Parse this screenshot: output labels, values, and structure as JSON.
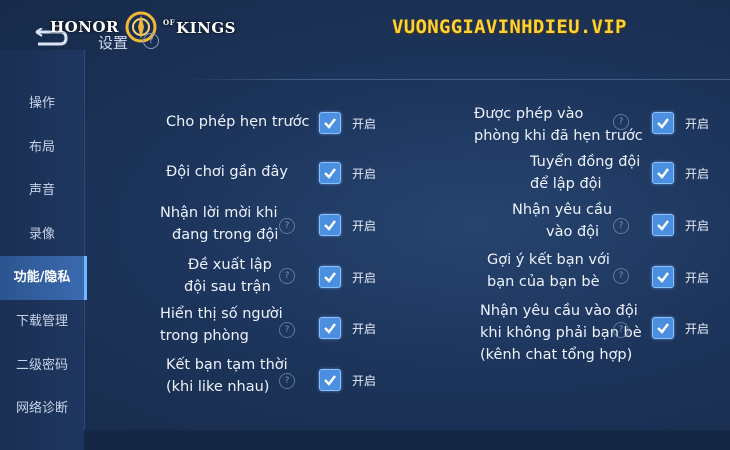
{
  "header": {
    "logo_left": "HONOR",
    "logo_of": "OF",
    "logo_right": "KINGS",
    "page_title": "设置",
    "watermark": "VUONGGIAVINHDIEU.VIP"
  },
  "sidebar": {
    "items": [
      {
        "label": "操作"
      },
      {
        "label": "布局"
      },
      {
        "label": "声音"
      },
      {
        "label": "录像"
      },
      {
        "label": "功能/隐私",
        "active": true
      },
      {
        "label": "下载管理"
      },
      {
        "label": "二级密码"
      },
      {
        "label": "网络诊断"
      }
    ]
  },
  "settings": {
    "left": [
      {
        "line1": "Cho phép hẹn trước",
        "line2": "",
        "checked": true,
        "state": "开启"
      },
      {
        "line1": "Đội chơi gần đây",
        "line2": "",
        "checked": true,
        "state": "开启"
      },
      {
        "line1": "Nhận lời mời khi",
        "line2": "đang trong đội",
        "checked": true,
        "state": "开启"
      },
      {
        "line1": "Đề xuất lập",
        "line2": "đội sau trận",
        "checked": true,
        "state": "开启"
      },
      {
        "line1": "Hiển thị số người",
        "line2": "trong phòng",
        "checked": true,
        "state": "开启"
      },
      {
        "line1": "Kết bạn tạm thời",
        "line2": "(khi like nhau)",
        "checked": true,
        "state": "开启"
      }
    ],
    "right": [
      {
        "line1": "Được phép  vào",
        "line2": "phòng khi đã hẹn trước",
        "line3": "",
        "checked": true,
        "state": "开启"
      },
      {
        "line1": "Tuyển đồng đội",
        "line2": "để lập đội",
        "line3": "",
        "checked": true,
        "state": "开启"
      },
      {
        "line1": "Nhận yêu cầu",
        "line2": "vào đội",
        "line3": "",
        "checked": true,
        "state": "开启"
      },
      {
        "line1": "Gợi ý kết bạn với",
        "line2": "bạn của bạn bè",
        "line3": "",
        "checked": true,
        "state": "开启"
      },
      {
        "line1": "Nhận yêu cầu vào đội",
        "line2": "khi không phải bạn bè",
        "line3": "(kênh chat tổng hợp)",
        "checked": true,
        "state": "开启"
      }
    ]
  },
  "colors": {
    "background": "#1d355c",
    "checkbox": "#4a8fe0",
    "active_tab": "#3b6ab0",
    "watermark": "#ffd233"
  },
  "icons": {
    "help": "question-mark-icon",
    "check": "checkmark-icon",
    "back": "back-arrow-icon"
  }
}
